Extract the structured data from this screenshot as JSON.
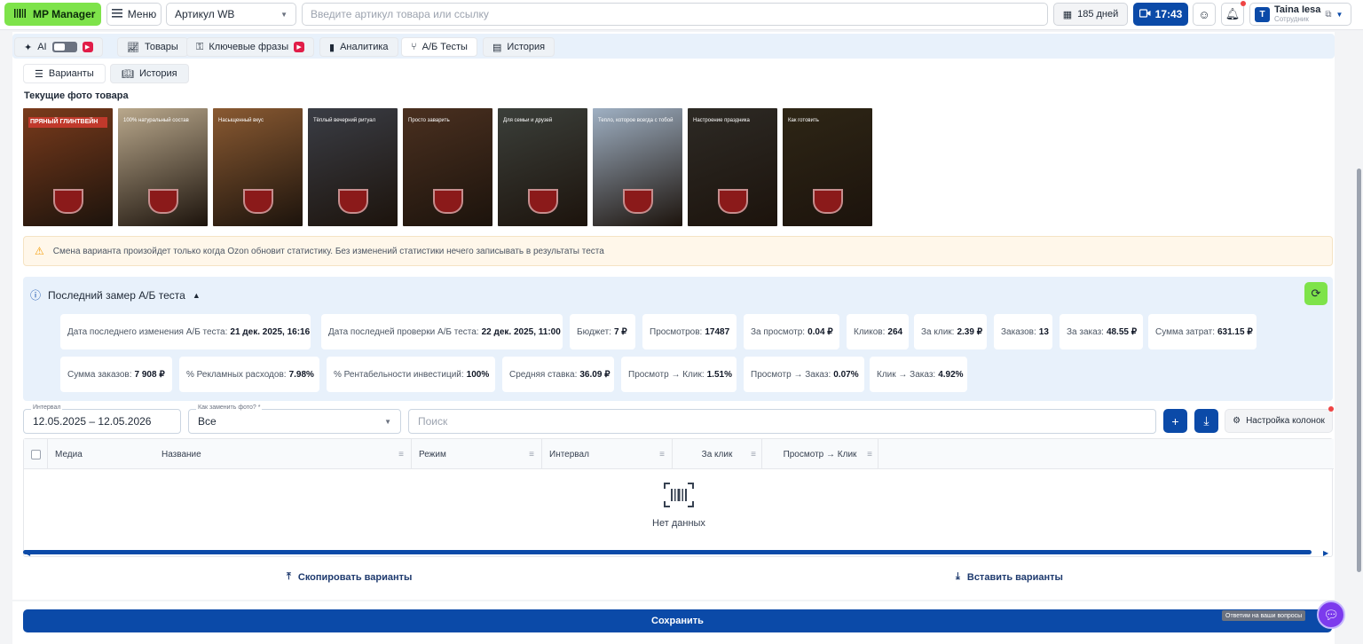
{
  "topbar": {
    "logo_label": "MP Manager",
    "menu_label": "Меню",
    "article_select": "Артикул WB",
    "search_placeholder": "Введите артикул товара или ссылку",
    "days_label": "185 дней",
    "time_label": "17:43",
    "user_initial": "T",
    "user_name": "Taina Iesa",
    "user_role": "Сотрудник"
  },
  "nav": {
    "ai_label": "AI",
    "items": [
      {
        "label": "Товары",
        "icon": "chart-icon"
      },
      {
        "label": "Ключевые фразы",
        "icon": "key-icon"
      },
      {
        "label": "Аналитика",
        "icon": "bar-chart-icon"
      },
      {
        "label": "А/Б Тесты",
        "icon": "split-icon",
        "active": true
      },
      {
        "label": "История",
        "icon": "history-icon"
      }
    ]
  },
  "subtabs": [
    {
      "label": "Варианты",
      "icon": "list-icon"
    },
    {
      "label": "История",
      "icon": "book-icon",
      "active": true
    }
  ],
  "photos_title": "Текущие фото товара",
  "photos": [
    {
      "caption": "ПРЯНЫЙ ГЛИНТВЕЙН",
      "bg": "#7a3b1c"
    },
    {
      "caption": "100% натуральный состав",
      "bg": "#b9a88c"
    },
    {
      "caption": "Насыщенный вкус",
      "bg": "#8a5a32"
    },
    {
      "caption": "Тёплый вечерний ритуал",
      "bg": "#3a3d45"
    },
    {
      "caption": "Просто заварить",
      "bg": "#4a3020"
    },
    {
      "caption": "Для семьи и друзей",
      "bg": "#3b3f3a"
    },
    {
      "caption": "Тепло, которое всегда с тобой",
      "bg": "#9fb0c3"
    },
    {
      "caption": "Настроение праздника",
      "bg": "#2d2a25"
    },
    {
      "caption": "Как готовить",
      "bg": "#2e2616"
    }
  ],
  "warning": "Смена варианта произойдет только когда Ozon обновит статистику. Без изменений статистики нечего записывать в результаты теста",
  "stats": {
    "title": "Последний замер А/Б теста",
    "row1": [
      {
        "label": "Дата последнего изменения А/Б теста:",
        "value": "21 дек. 2025, 16:16"
      },
      {
        "label": "Дата последней проверки А/Б теста:",
        "value": "22 дек. 2025, 11:00"
      },
      {
        "label": "Бюджет:",
        "value": "7 ₽"
      },
      {
        "label": "Просмотров:",
        "value": "17487"
      },
      {
        "label": "За просмотр:",
        "value": "0.04 ₽"
      },
      {
        "label": "Кликов:",
        "value": "264"
      },
      {
        "label": "За клик:",
        "value": "2.39 ₽"
      },
      {
        "label": "Заказов:",
        "value": "13"
      },
      {
        "label": "За заказ:",
        "value": "48.55 ₽"
      },
      {
        "label": "Сумма затрат:",
        "value": "631.15 ₽"
      }
    ],
    "row2": [
      {
        "label": "Сумма заказов:",
        "value": "7 908 ₽"
      },
      {
        "label": "% Рекламных расходов:",
        "value": "7.98%"
      },
      {
        "label": "% Рентабельности инвестиций:",
        "value": "100%"
      },
      {
        "label": "Средняя ставка:",
        "value": "36.09 ₽"
      },
      {
        "label": "Просмотр → Клик:",
        "value": "1.51%"
      },
      {
        "label": "Просмотр → Заказ:",
        "value": "0.07%"
      },
      {
        "label": "Клик → Заказ:",
        "value": "4.92%"
      }
    ]
  },
  "filters": {
    "interval_label": "Интервал",
    "interval_value": "12.05.2025 – 12.05.2026",
    "replace_label": "Как заменить фото? *",
    "replace_value": "Все",
    "search_placeholder": "Поиск",
    "columns_button": "Настройка колонок"
  },
  "table": {
    "columns": [
      "Медиа",
      "Название",
      "Режим",
      "Интервал",
      "За клик",
      "Просмотр → Клик"
    ],
    "empty_text": "Нет данных"
  },
  "actions": {
    "copy_label": "Скопировать варианты",
    "paste_label": "Вставить варианты",
    "save_label": "Сохранить"
  },
  "chat": {
    "label": "Ответим на ваши вопросы"
  }
}
